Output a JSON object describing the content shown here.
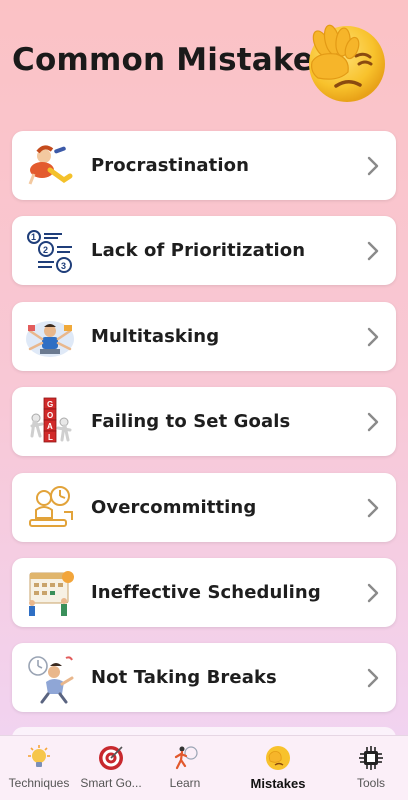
{
  "header": {
    "title": "Common Mistakes",
    "emoji_icon": "facepalm-emoji-icon"
  },
  "items": [
    {
      "label": "Procrastination",
      "icon": "procrastination-icon"
    },
    {
      "label": "Lack of Prioritization",
      "icon": "numbered-priority-list-icon"
    },
    {
      "label": "Multitasking",
      "icon": "multitasking-person-icon"
    },
    {
      "label": "Failing to Set Goals",
      "icon": "goal-blocks-icon"
    },
    {
      "label": "Overcommitting",
      "icon": "overcommitting-clock-icon"
    },
    {
      "label": "Ineffective Scheduling",
      "icon": "calendar-scheduling-icon"
    },
    {
      "label": "Not Taking Breaks",
      "icon": "tired-person-icon"
    }
  ],
  "nav": {
    "items": [
      {
        "label": "Techniques",
        "icon": "lightbulb-icon"
      },
      {
        "label": "Smart Go...",
        "icon": "target-icon"
      },
      {
        "label": "Learn",
        "icon": "runner-icon"
      },
      {
        "label": "Mistakes",
        "icon": "facepalm-icon",
        "active": true
      },
      {
        "label": "Tools",
        "icon": "ai-chip-icon"
      }
    ]
  },
  "colors": {
    "background_top": "#fbc2c5",
    "background_bottom": "#efd6f4",
    "card": "#ffffff",
    "text": "#1e1e1e",
    "chevron": "#8a8a8a"
  }
}
